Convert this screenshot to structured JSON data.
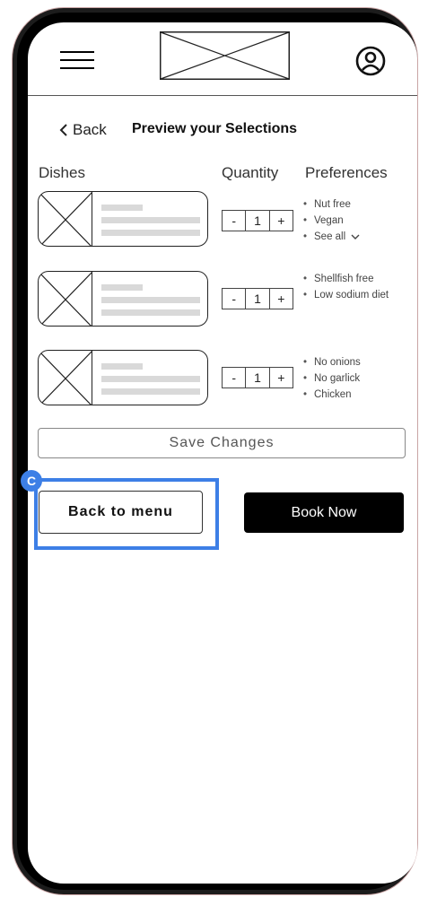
{
  "header": {
    "menu_icon": "hamburger-icon",
    "logo_icon": "logo-placeholder",
    "profile_icon": "profile-icon"
  },
  "nav": {
    "back_label": "Back",
    "back_icon": "chevron-left-icon",
    "title": "Preview your Selections"
  },
  "columns": {
    "dishes": "Dishes",
    "quantity": "Quantity",
    "preferences": "Preferences"
  },
  "dishes": [
    {
      "quantity": "1",
      "minus": "-",
      "plus": "+",
      "preferences": [
        "Nut free",
        "Vegan",
        "See all"
      ]
    },
    {
      "quantity": "1",
      "minus": "-",
      "plus": "+",
      "preferences": [
        "Shellfish free",
        "Low sodium diet"
      ]
    },
    {
      "quantity": "1",
      "minus": "-",
      "plus": "+",
      "preferences": [
        "No onions",
        "No garlick",
        "Chicken"
      ]
    }
  ],
  "actions": {
    "save_changes": "Save Changes",
    "back_to_menu": "Back to menu",
    "book_now": "Book Now",
    "badge_letter": "C"
  },
  "colors": {
    "highlight": "#3d7fe6",
    "primary_button": "#000000",
    "placeholder_bar": "#d9d9d9"
  }
}
